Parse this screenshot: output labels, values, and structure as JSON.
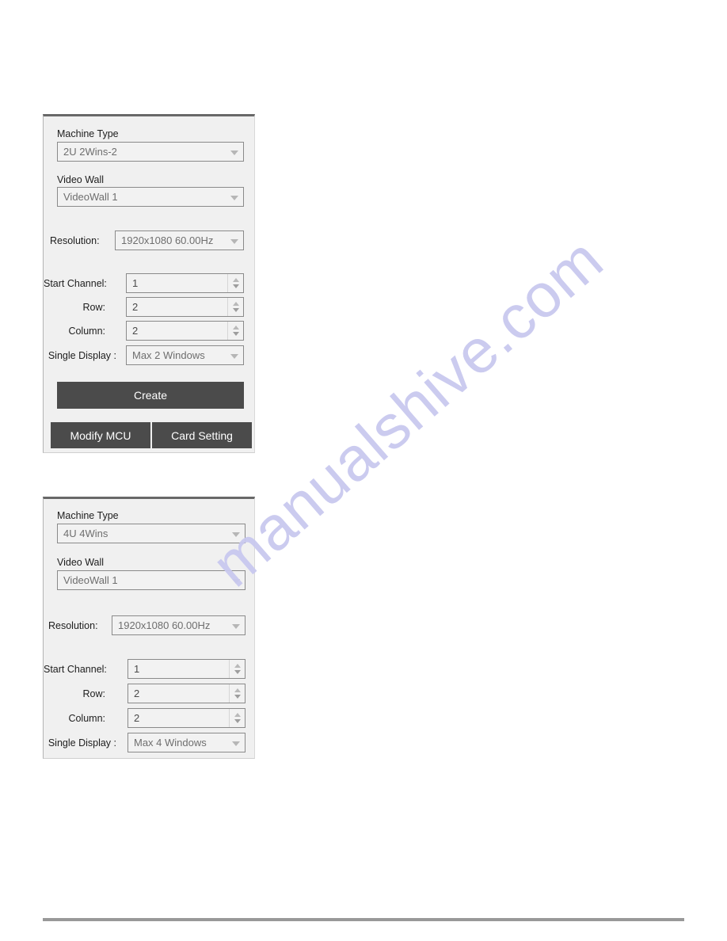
{
  "page": {
    "watermark": "manualshive.com"
  },
  "panel_one": {
    "machine_type": {
      "label": "Machine Type",
      "value": "2U 2Wins-2",
      "icon": "chevron-down-icon"
    },
    "video_wall": {
      "label": "Video Wall",
      "value": "VideoWall 1",
      "icon": "chevron-down-icon"
    },
    "resolution": {
      "label": "Resolution:",
      "value": "1920x1080 60.00Hz",
      "icon": "chevron-down-icon"
    },
    "start_channel": {
      "label": "Start Channel:",
      "value": "1",
      "icon": "spinner-icon"
    },
    "row": {
      "label": "Row:",
      "value": "2",
      "icon": "spinner-icon"
    },
    "column": {
      "label": "Column:",
      "value": "2",
      "icon": "spinner-icon"
    },
    "single_display": {
      "label": "Single Display :",
      "value": "Max 2 Windows",
      "icon": "chevron-down-icon"
    },
    "create_button": "Create",
    "modify_mcu_button": "Modify MCU",
    "card_setting_button": "Card Setting"
  },
  "panel_two": {
    "machine_type": {
      "label": "Machine Type",
      "value": "4U 4Wins",
      "icon": "chevron-down-icon"
    },
    "video_wall": {
      "label": "Video Wall",
      "value": "VideoWall 1",
      "icon": "chevron-down-icon"
    },
    "resolution": {
      "label": "Resolution:",
      "value": "1920x1080 60.00Hz",
      "icon": "chevron-down-icon"
    },
    "start_channel": {
      "label": "Start Channel:",
      "value": "1",
      "icon": "spinner-icon"
    },
    "row": {
      "label": "Row:",
      "value": "2",
      "icon": "spinner-icon"
    },
    "column": {
      "label": "Column:",
      "value": "2",
      "icon": "spinner-icon"
    },
    "single_display": {
      "label": "Single Display :",
      "value": "Max 4 Windows",
      "icon": "chevron-down-icon"
    }
  }
}
